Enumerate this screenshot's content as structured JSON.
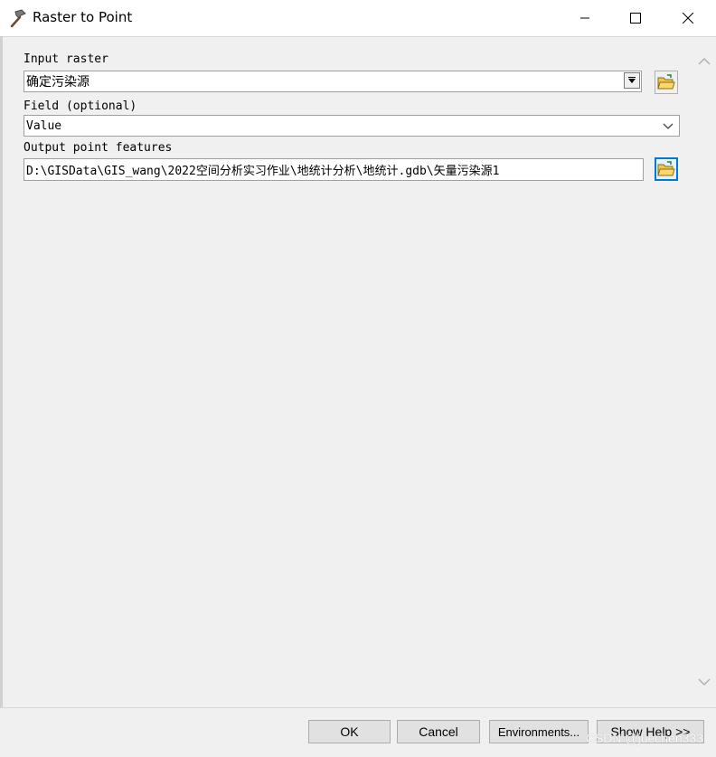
{
  "window": {
    "title": "Raster to Point",
    "icon": "hammer-icon",
    "controls": [
      "minimize-icon",
      "maximize-icon",
      "close-icon"
    ]
  },
  "form": {
    "input_raster": {
      "label": "Input raster",
      "value": "确定污染源"
    },
    "field": {
      "label": "Field (optional)",
      "value": "Value"
    },
    "output": {
      "label": "Output point features",
      "value": "D:\\GISData\\GIS_wang\\2022空间分析实习作业\\地统计分析\\地统计.gdb\\矢量污染源1"
    }
  },
  "buttons": {
    "ok": "OK",
    "cancel": "Cancel",
    "environments": "Environments...",
    "show_help": "Show Help >>"
  },
  "watermark": "CSDN @juechen333",
  "colors": {
    "accent": "#0078d7",
    "folder": "#f4c542"
  }
}
